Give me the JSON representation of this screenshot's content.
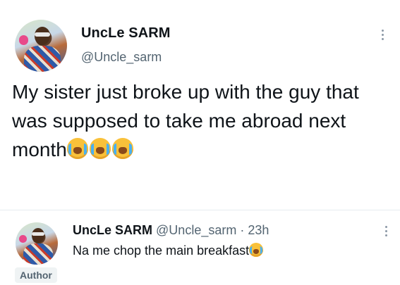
{
  "main_tweet": {
    "author_name": "UncLe SARM",
    "handle": "@Uncle_sarm",
    "text": "My sister just broke up with the guy that was supposed to take me abroad next month",
    "emojis": [
      "loudly-crying-face",
      "loudly-crying-face",
      "loudly-crying-face"
    ]
  },
  "reply": {
    "author_name": "UncLe SARM",
    "handle": "@Uncle_sarm",
    "separator": "·",
    "time": "23h",
    "text": "Na me chop the main breakfast",
    "emojis": [
      "loudly-crying-face"
    ],
    "badge": "Author"
  },
  "icons": {
    "menu": "more-vertical-icon",
    "emoji": "loudly-crying-face"
  },
  "colors": {
    "text": "#0f1419",
    "secondary_text": "#536471",
    "badge_bg": "#eff3f4",
    "divider": "#e6ecf0"
  }
}
